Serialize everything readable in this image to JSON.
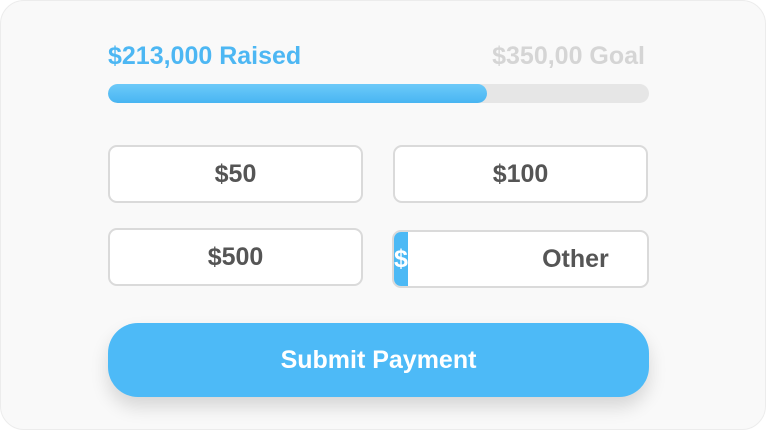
{
  "donation": {
    "raised_label": "$213,000 Raised",
    "goal_label": "$350,00 Goal",
    "progress_fraction": 0.7
  },
  "amounts": {
    "option_1": "$50",
    "option_2": "$100",
    "option_3": "$500"
  },
  "other": {
    "currency_symbol": "$",
    "placeholder": "Other"
  },
  "submit": {
    "label": "Submit Payment"
  },
  "colors": {
    "accent": "#4db7f3",
    "track": "#e6e6e6",
    "goal_text": "#d5d5d5",
    "button_text": "#555555"
  }
}
